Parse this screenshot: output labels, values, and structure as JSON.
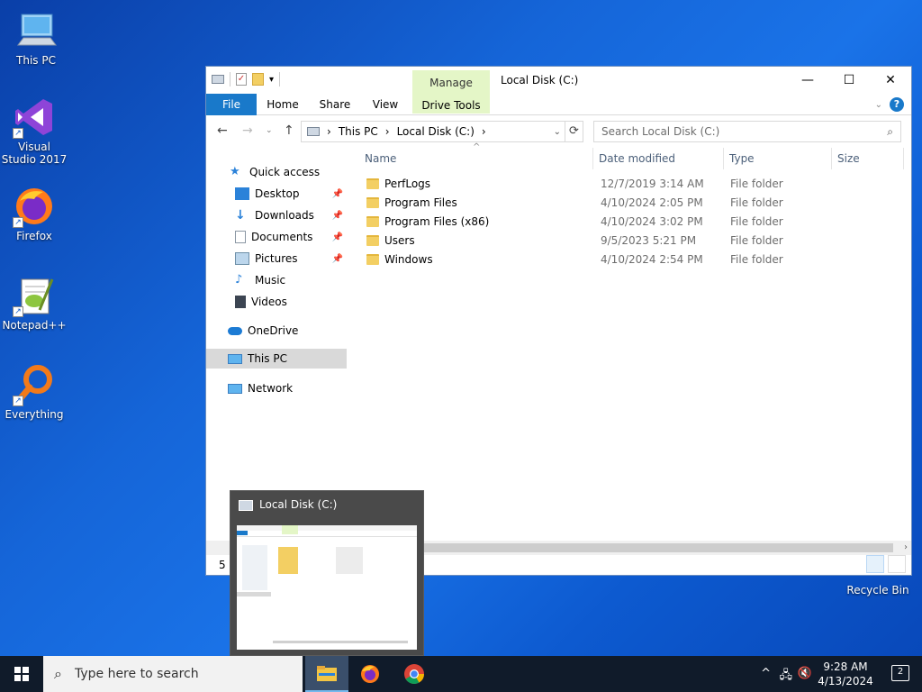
{
  "desktop": {
    "icons": [
      {
        "label": "This PC",
        "name": "this-pc"
      },
      {
        "label": "Visual Studio 2017",
        "name": "visual-studio-2017"
      },
      {
        "label": "Firefox",
        "name": "firefox"
      },
      {
        "label": "Notepad++",
        "name": "notepad-plus-plus"
      },
      {
        "label": "Everything",
        "name": "everything"
      },
      {
        "label": "Recycle Bin",
        "name": "recycle-bin"
      }
    ]
  },
  "window": {
    "title": "Local Disk (C:)",
    "context_tab_group": "Manage",
    "context_tab": "Drive Tools",
    "tabs": [
      "File",
      "Home",
      "Share",
      "View"
    ],
    "controls": {
      "minimize": "—",
      "maximize": "☐",
      "close": "✕"
    },
    "help": "?"
  },
  "address": {
    "breadcrumbs": [
      "This PC",
      "Local Disk (C:)"
    ],
    "search_placeholder": "Search Local Disk (C:)"
  },
  "navpane": {
    "items": [
      {
        "label": "Quick access",
        "pinned": false
      },
      {
        "label": "Desktop",
        "pinned": true
      },
      {
        "label": "Downloads",
        "pinned": true
      },
      {
        "label": "Documents",
        "pinned": true
      },
      {
        "label": "Pictures",
        "pinned": true
      },
      {
        "label": "Music",
        "pinned": false
      },
      {
        "label": "Videos",
        "pinned": false
      },
      {
        "label": "OneDrive",
        "pinned": false
      },
      {
        "label": "This PC",
        "pinned": false
      },
      {
        "label": "Network",
        "pinned": false
      }
    ],
    "selected": "This PC"
  },
  "files": {
    "columns": [
      "Name",
      "Date modified",
      "Type",
      "Size"
    ],
    "rows": [
      {
        "name": "PerfLogs",
        "date": "12/7/2019 3:14 AM",
        "type": "File folder"
      },
      {
        "name": "Program Files",
        "date": "4/10/2024 2:05 PM",
        "type": "File folder"
      },
      {
        "name": "Program Files (x86)",
        "date": "4/10/2024 3:02 PM",
        "type": "File folder"
      },
      {
        "name": "Users",
        "date": "9/5/2023 5:21 PM",
        "type": "File folder"
      },
      {
        "name": "Windows",
        "date": "4/10/2024 2:54 PM",
        "type": "File folder"
      }
    ]
  },
  "status": {
    "items_count": "5 ite"
  },
  "preview": {
    "title": "Local Disk (C:)"
  },
  "taskbar": {
    "search_placeholder": "Type here to search",
    "time": "9:28 AM",
    "date": "4/13/2024",
    "notifications": "2"
  },
  "colors": {
    "accent": "#1979ca",
    "manage_tab": "#e4f6c7",
    "taskbar": "#101b2a"
  }
}
